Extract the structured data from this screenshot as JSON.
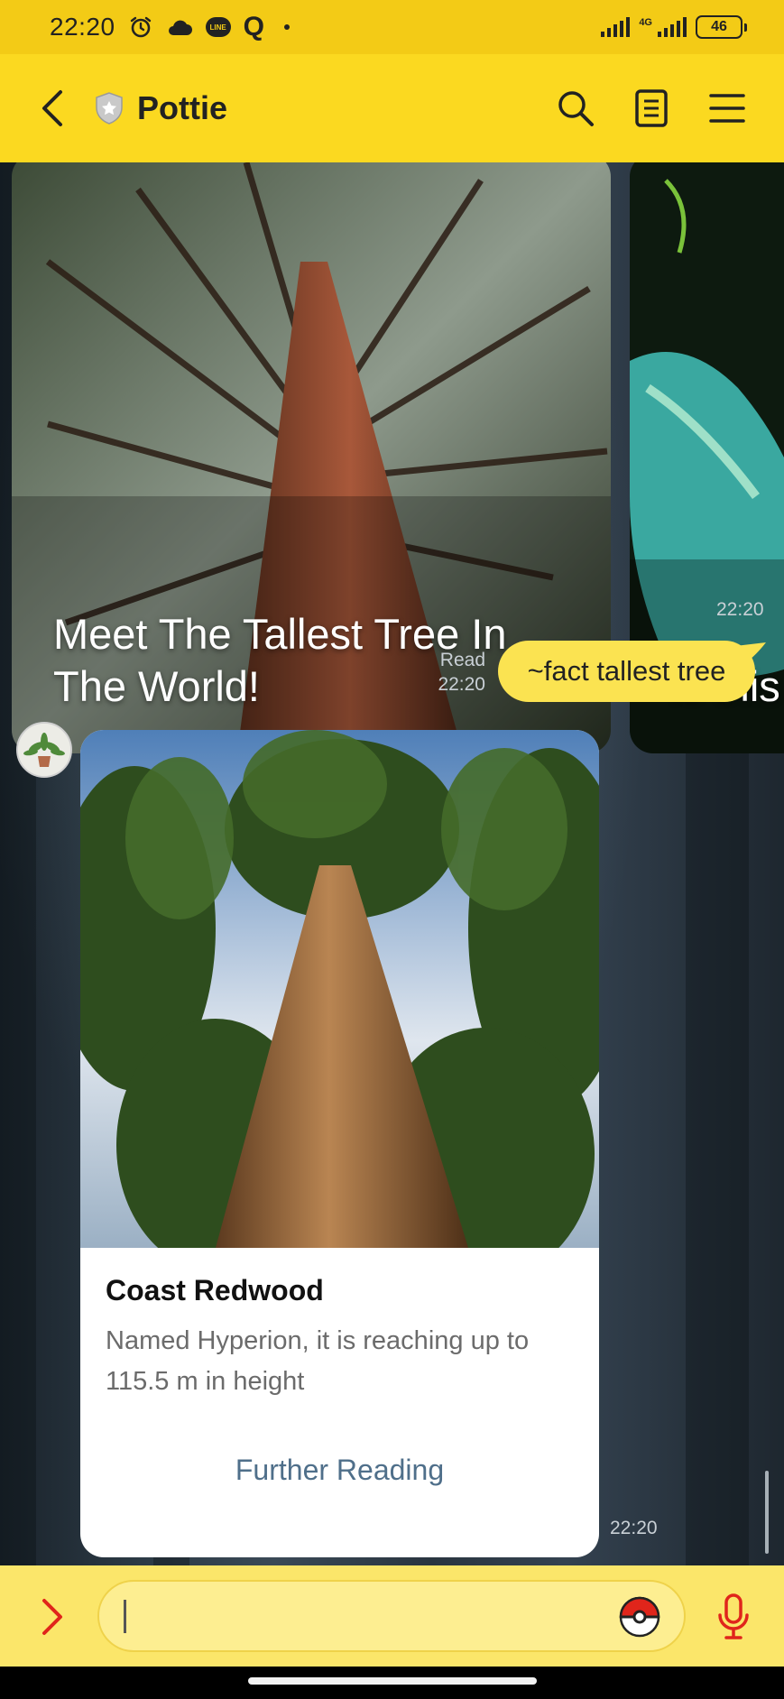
{
  "status_bar": {
    "time": "22:20",
    "q_label": "Q",
    "line_label": "LINE",
    "network_type": "4G",
    "battery": "46"
  },
  "header": {
    "title": "Pottie",
    "icons": [
      "back-arrow-icon",
      "shield-icon",
      "search-icon",
      "notes-icon",
      "menu-icon"
    ]
  },
  "messages": {
    "carousel": [
      {
        "caption": "Meet The Tallest Tree In The World!"
      },
      {
        "caption": "Is this"
      }
    ],
    "carousel_time": "22:20",
    "outgoing": {
      "text": "~fact tallest tree",
      "read_label": "Read",
      "time": "22:20"
    },
    "fact_card": {
      "title": "Coast Redwood",
      "body": "Named Hyperion, it is reaching up to 115.5 m in height",
      "link_label": "Further Reading",
      "time": "22:20"
    }
  },
  "input_bar": {
    "value": "",
    "icons": [
      "chevron-right-icon",
      "pokeball-sticker-icon",
      "microphone-icon"
    ]
  },
  "colors": {
    "accent_yellow": "#fbd920",
    "status_yellow": "#f3cb16",
    "bubble_yellow": "#fbe351",
    "link_blue": "#4f6f8a"
  }
}
